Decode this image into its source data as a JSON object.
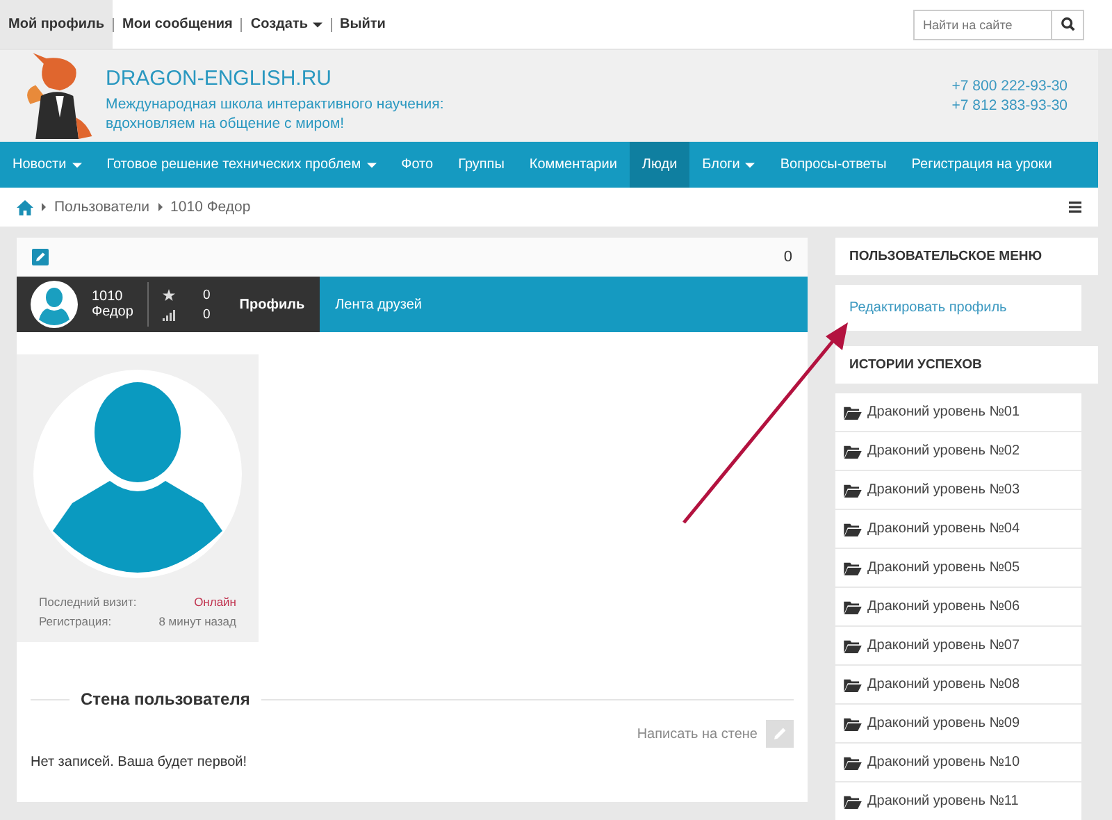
{
  "top_bar": {
    "links": [
      {
        "label": "Мой профиль",
        "selected": true,
        "dropdown": false
      },
      {
        "label": "Мои сообщения",
        "selected": false,
        "dropdown": false
      },
      {
        "label": "Создать",
        "selected": false,
        "dropdown": true
      },
      {
        "label": "Выйти",
        "selected": false,
        "dropdown": false
      }
    ],
    "search": {
      "placeholder": "Найти на сайте"
    }
  },
  "header": {
    "site_name": "DRAGON-ENGLISH.RU",
    "tagline": "Международная школа интерактивного научения: вдохновляем на общение с миром!",
    "phones": [
      "+7 800 222-93-30",
      "+7 812 383-93-30"
    ]
  },
  "nav": [
    {
      "label": "Новости",
      "selected": false,
      "dropdown": true
    },
    {
      "label": "Готовое решение технических проблем",
      "selected": false,
      "dropdown": true
    },
    {
      "label": "Фото",
      "selected": false,
      "dropdown": false
    },
    {
      "label": "Группы",
      "selected": false,
      "dropdown": false
    },
    {
      "label": "Комментарии",
      "selected": false,
      "dropdown": false
    },
    {
      "label": "Люди",
      "selected": true,
      "dropdown": false
    },
    {
      "label": "Блоги",
      "selected": false,
      "dropdown": true
    },
    {
      "label": "Вопросы-ответы",
      "selected": false,
      "dropdown": false
    },
    {
      "label": "Регистрация на уроки",
      "selected": false,
      "dropdown": false
    }
  ],
  "breadcrumb": [
    "Пользователи",
    "1010 Федор"
  ],
  "profile": {
    "count": "0",
    "name": [
      "1010",
      "Федор"
    ],
    "rating": "0",
    "karma": "0",
    "tabs": [
      {
        "label": "Профиль",
        "selected": true
      },
      {
        "label": "Лента друзей",
        "selected": false
      }
    ],
    "details": [
      {
        "label": "Последний визит:",
        "value": "Онлайн",
        "kind": "status"
      },
      {
        "label": "Регистрация:",
        "value": "8 минут назад",
        "kind": "text"
      }
    ],
    "wall": {
      "title": "Стена пользователя",
      "write_label": "Написать на стене",
      "empty": "Нет записей. Ваша будет первой!"
    }
  },
  "sidebar": {
    "menu_title": "ПОЛЬЗОВАТЕЛЬСКОЕ МЕНЮ",
    "menu_links": [
      "Редактировать профиль"
    ],
    "stories_title": "ИСТОРИИ УСПЕХОВ",
    "stories": [
      "Драконий уровень №01",
      "Драконий уровень №02",
      "Драконий уровень №03",
      "Драконий уровень №04",
      "Драконий уровень №05",
      "Драконий уровень №06",
      "Драконий уровень №07",
      "Драконий уровень №08",
      "Драконий уровень №09",
      "Драконий уровень №10",
      "Драконий уровень №11"
    ]
  }
}
